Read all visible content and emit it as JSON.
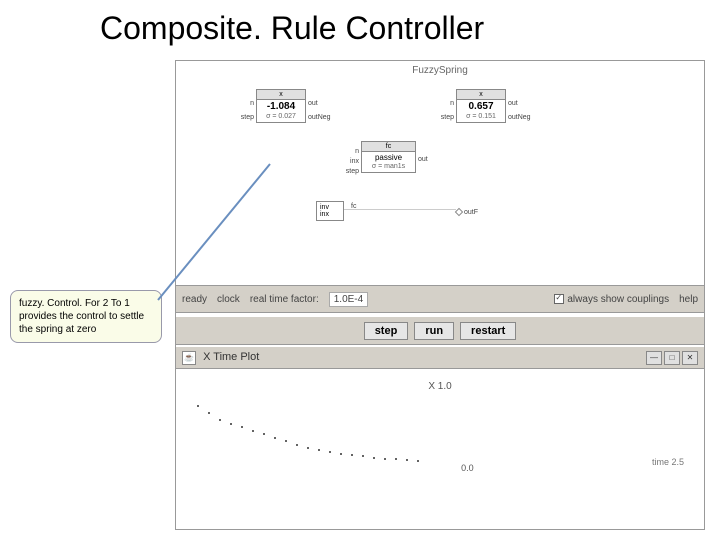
{
  "title": "Composite. Rule Controller",
  "diagram": {
    "label": "FuzzySpring",
    "block1": {
      "header": "x",
      "value": "-1.084",
      "stat": "σ = 0.027",
      "ports_left": [
        "n",
        "step"
      ],
      "ports_right": [
        "out",
        "outNeg"
      ]
    },
    "block2": {
      "header": "x",
      "value": "0.657",
      "stat": "σ = 0.151",
      "ports_left": [
        "n",
        "step"
      ],
      "ports_right": [
        "out",
        "outNeg"
      ]
    },
    "block3": {
      "header": "fc",
      "value": "passive",
      "stat": "σ = man1s",
      "ports_left": [
        "n",
        "inx",
        "step"
      ],
      "ports_right": [
        "out"
      ]
    },
    "block4": {
      "lines": [
        "inv",
        "inx"
      ],
      "header": "fc",
      "port_right": "outF"
    }
  },
  "toolbar": {
    "ready": "ready",
    "clock": "clock",
    "rtf": "real time factor:",
    "rtf_val": "1.0E-4",
    "always": "always show couplings",
    "help": "help"
  },
  "buttons": {
    "step": "step",
    "run": "run",
    "restart": "restart"
  },
  "plotbar": {
    "title": "X Time Plot",
    "min": "—",
    "max": "□",
    "close": "✕"
  },
  "plot": {
    "ylabel": "X 1.0",
    "zero": "0.0",
    "time": "time 2.5"
  },
  "callout": "fuzzy. Control. For 2 To 1 provides the control to settle the spring at zero",
  "chart_data": {
    "type": "scatter",
    "title": "X Time Plot",
    "xlabel": "time",
    "ylabel": "X",
    "xlim": [
      0,
      2.5
    ],
    "ylim": [
      -1,
      1
    ],
    "series": [
      {
        "name": "x",
        "x": [
          0.1,
          0.2,
          0.3,
          0.4,
          0.5,
          0.6,
          0.7,
          0.8,
          0.9,
          1.0,
          1.1,
          1.2,
          1.3,
          1.4,
          1.5,
          1.6,
          1.7,
          1.8,
          1.9,
          2.0,
          2.1
        ],
        "y": [
          0.8,
          0.7,
          0.6,
          0.55,
          0.5,
          0.45,
          0.4,
          0.35,
          0.3,
          0.25,
          0.2,
          0.17,
          0.15,
          0.12,
          0.1,
          0.08,
          0.06,
          0.05,
          0.04,
          0.03,
          0.02
        ]
      }
    ]
  }
}
